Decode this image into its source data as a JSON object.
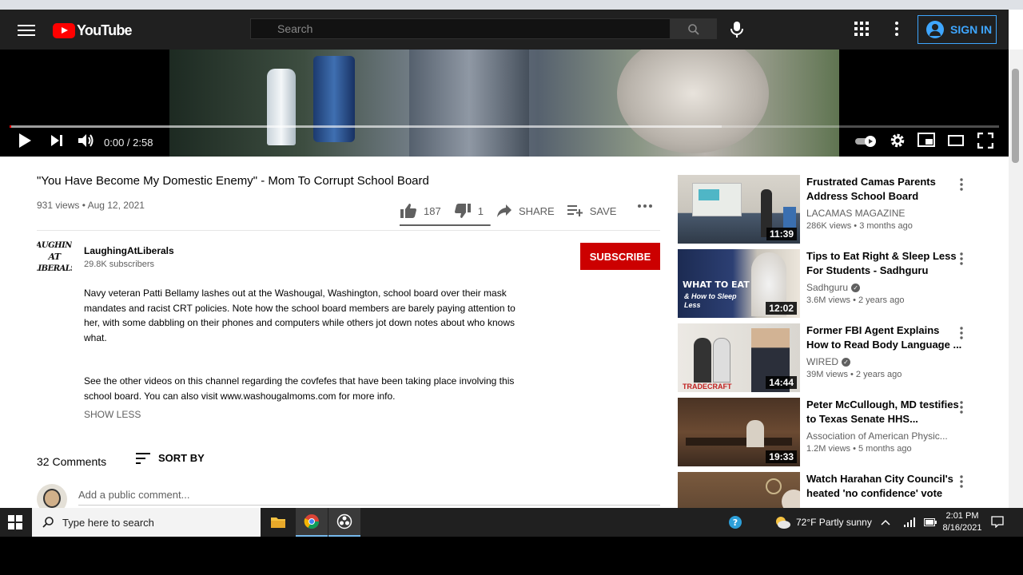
{
  "header": {
    "logo_text": "YouTube",
    "search_placeholder": "Search",
    "sign_in_label": "SIGN IN"
  },
  "player": {
    "current_time": "0:00",
    "duration": "2:58",
    "time_separator": " / ",
    "progress_fraction": 0.0,
    "buffered_fraction": 0.72
  },
  "video": {
    "title": "\"You Have Become My Domestic Enemy\" - Mom To Corrupt School Board",
    "views_date": "931 views • Aug 12, 2021",
    "likes": "187",
    "dislikes": "1",
    "like_fraction": 0.99,
    "share_label": "SHARE",
    "save_label": "SAVE"
  },
  "channel": {
    "avatar_text": "LAUGHING AT LIBERALS",
    "name": "LaughingAtLiberals",
    "subscribers": "29.8K subscribers",
    "subscribe_label": "SUBSCRIBE"
  },
  "description": {
    "paragraph1": "Navy veteran Patti Bellamy lashes out at the Washougal, Washington, school board over their mask mandates and racist CRT policies. Note how the school board members are barely paying attention to her, with some dabbling on their phones and computers while others jot down notes about who knows what.",
    "paragraph2": "See the other videos on this channel regarding the covfefes that have been taking place involving this school board. You can also visit www.washougalmoms.com for more info.",
    "show_less": "SHOW LESS"
  },
  "comments": {
    "count": "32 Comments",
    "sort_label": "SORT BY",
    "add_placeholder": "Add a public comment..."
  },
  "related": [
    {
      "title": "Frustrated Camas Parents Address School Board",
      "channel": "LACAMAS MAGAZINE",
      "verified": false,
      "meta": "286K views • 3 months ago",
      "duration": "11:39"
    },
    {
      "title": "Tips to Eat Right & Sleep Less For Students - Sadhguru",
      "channel": "Sadhguru",
      "verified": true,
      "meta": "3.6M views • 2 years ago",
      "duration": "12:02",
      "thumb_text1": "WHAT TO EAT",
      "thumb_text2": "& How to Sleep Less"
    },
    {
      "title": "Former FBI Agent Explains How to Read Body Language ...",
      "channel": "WIRED",
      "verified": true,
      "meta": "39M views • 2 years ago",
      "duration": "14:44",
      "thumb_text1": "TRADECRAFT"
    },
    {
      "title": "Peter McCullough, MD testifies to Texas Senate HHS...",
      "channel": "Association of American Physic...",
      "verified": false,
      "meta": "1.2M views • 5 months ago",
      "duration": "19:33"
    },
    {
      "title": "Watch Harahan City Council's heated 'no confidence' vote",
      "channel": "",
      "verified": false,
      "meta": "",
      "duration": ""
    }
  ],
  "taskbar": {
    "search_placeholder": "Type here to search",
    "weather": "72°F  Partly sunny",
    "time": "2:01 PM",
    "date": "8/16/2021"
  }
}
